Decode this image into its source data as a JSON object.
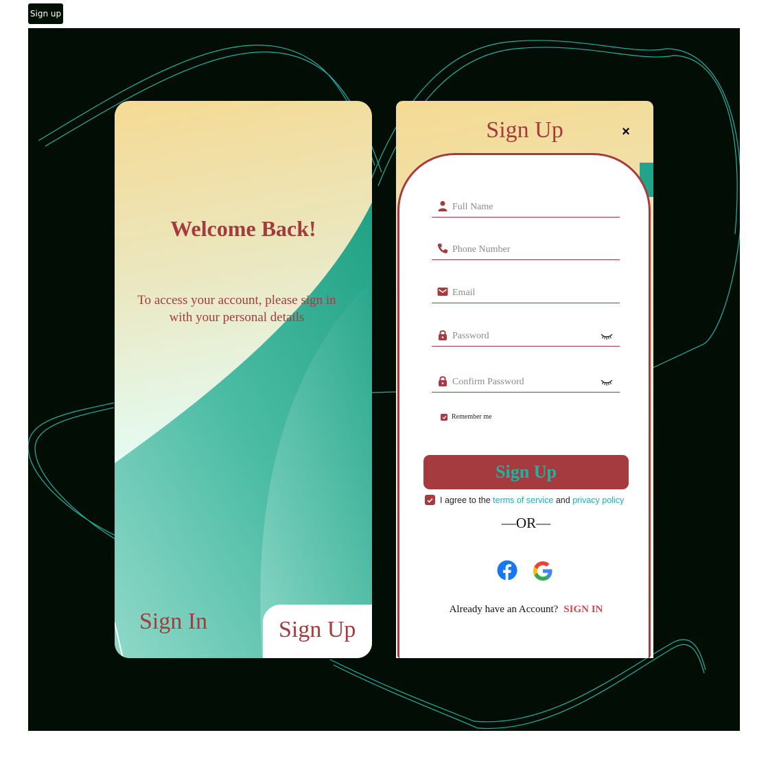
{
  "page_badge": "Sign up",
  "colors": {
    "brand": "#a63b3f",
    "teal": "#23a38a",
    "link": "#18b2ad",
    "background": "#020e05"
  },
  "left_card": {
    "title": "Welcome Back!",
    "subtitle": "To access your account, please sign in with your personal details",
    "signin_tab": "Sign In",
    "signup_tab": "Sign Up"
  },
  "right_card": {
    "title": "Sign Up",
    "close_icon": "×",
    "fields": {
      "full_name": {
        "placeholder": "Full Name",
        "icon": "user-icon"
      },
      "phone": {
        "placeholder": "Phone Number",
        "icon": "phone-icon"
      },
      "email": {
        "placeholder": "Email",
        "icon": "mail-icon"
      },
      "password": {
        "placeholder": "Password",
        "icon": "lock-icon"
      },
      "confirm_password": {
        "placeholder": "Confirm Password",
        "icon": "lock-icon"
      }
    },
    "remember_me": "Remember me",
    "submit": "Sign Up",
    "agree": {
      "prefix": "I agree to the",
      "terms": "terms of service",
      "and": "and",
      "privacy": "privacy policy"
    },
    "or": "—OR—",
    "already_text": "Already have an Account?",
    "signin_link": "SIGN IN"
  }
}
